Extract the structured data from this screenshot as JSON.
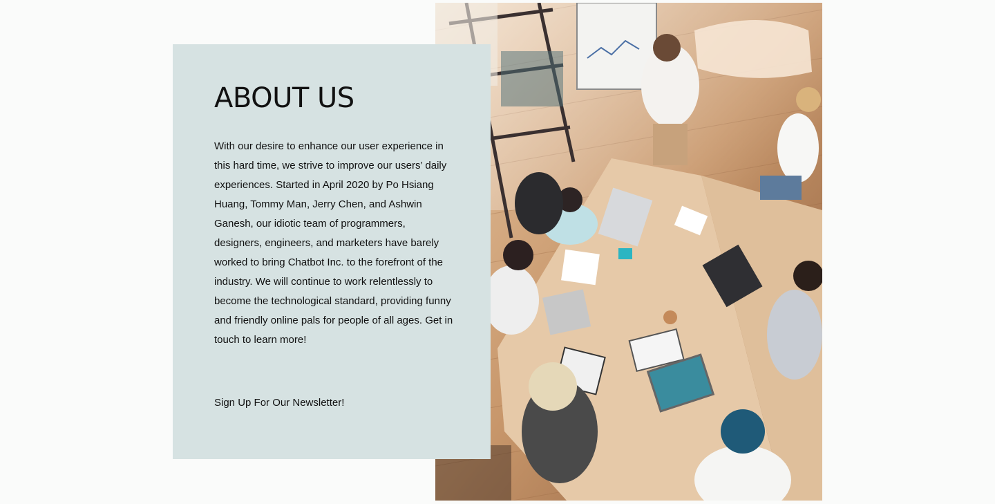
{
  "about": {
    "title": "ABOUT US",
    "body": "With our desire to enhance our user experience in this hard time, we strive to improve our users’ daily experiences. Started in April 2020 by Po Hsiang Huang, Tommy Man, Jerry Chen, and Ashwin Ganesh, our idiotic team of programmers, designers, engineers, and marketers have barely worked to bring Chatbot Inc. to the forefront of the industry. We will continue to work relentlessly to become the technological standard, providing funny and friendly online pals for people of all ages. Get in touch to learn more!",
    "newsletter_link": "Sign Up For Our Newsletter!"
  },
  "colors": {
    "page_background": "#fafbfa",
    "card_background": "#d6e2e2",
    "text": "#111111"
  }
}
